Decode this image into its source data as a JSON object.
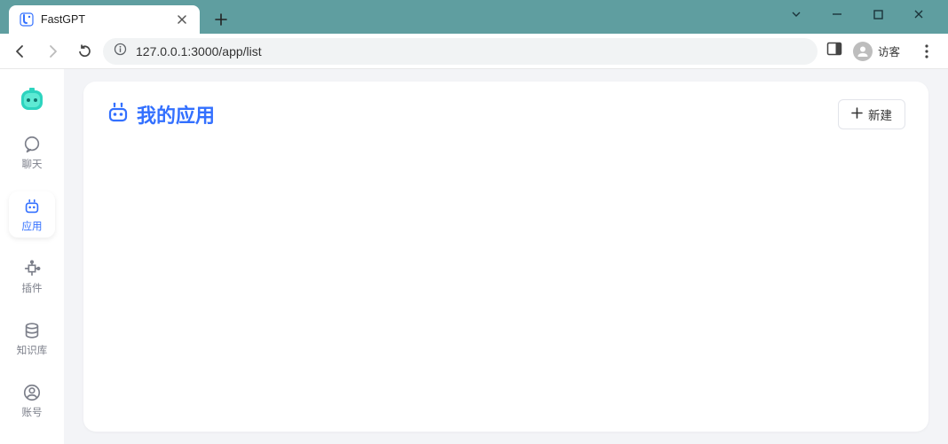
{
  "browser": {
    "tab_title": "FastGPT",
    "url": "127.0.0.1:3000/app/list",
    "profile_label": "访客"
  },
  "sidebar": {
    "items": [
      {
        "label": "聊天"
      },
      {
        "label": "应用"
      },
      {
        "label": "插件"
      },
      {
        "label": "知识库"
      },
      {
        "label": "账号"
      }
    ]
  },
  "page": {
    "title": "我的应用",
    "create_label": "新建"
  }
}
